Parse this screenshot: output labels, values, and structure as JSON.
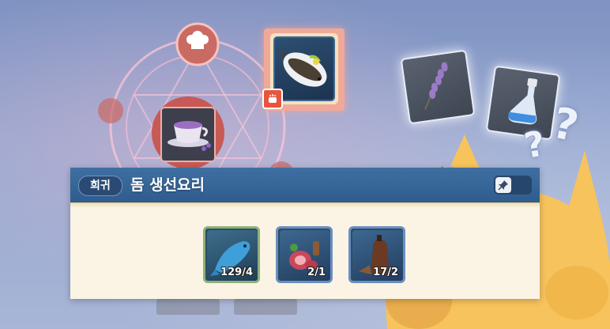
{
  "recipe": {
    "rarity": "희귀",
    "name": "돔 생선요리"
  },
  "ingredients": [
    {
      "name": "fish",
      "count": "129/4"
    },
    {
      "name": "meat",
      "count": "2/1"
    },
    {
      "name": "pepper",
      "count": "17/2"
    }
  ],
  "colors": {
    "header": "#3a689b",
    "panel": "#fbf4e4",
    "badge": "#2a4a73",
    "accent": "#f0a998"
  },
  "icons": {
    "chef_hat": "chef-hat-icon",
    "pin": "pin-icon",
    "cook": "cook-icon"
  }
}
